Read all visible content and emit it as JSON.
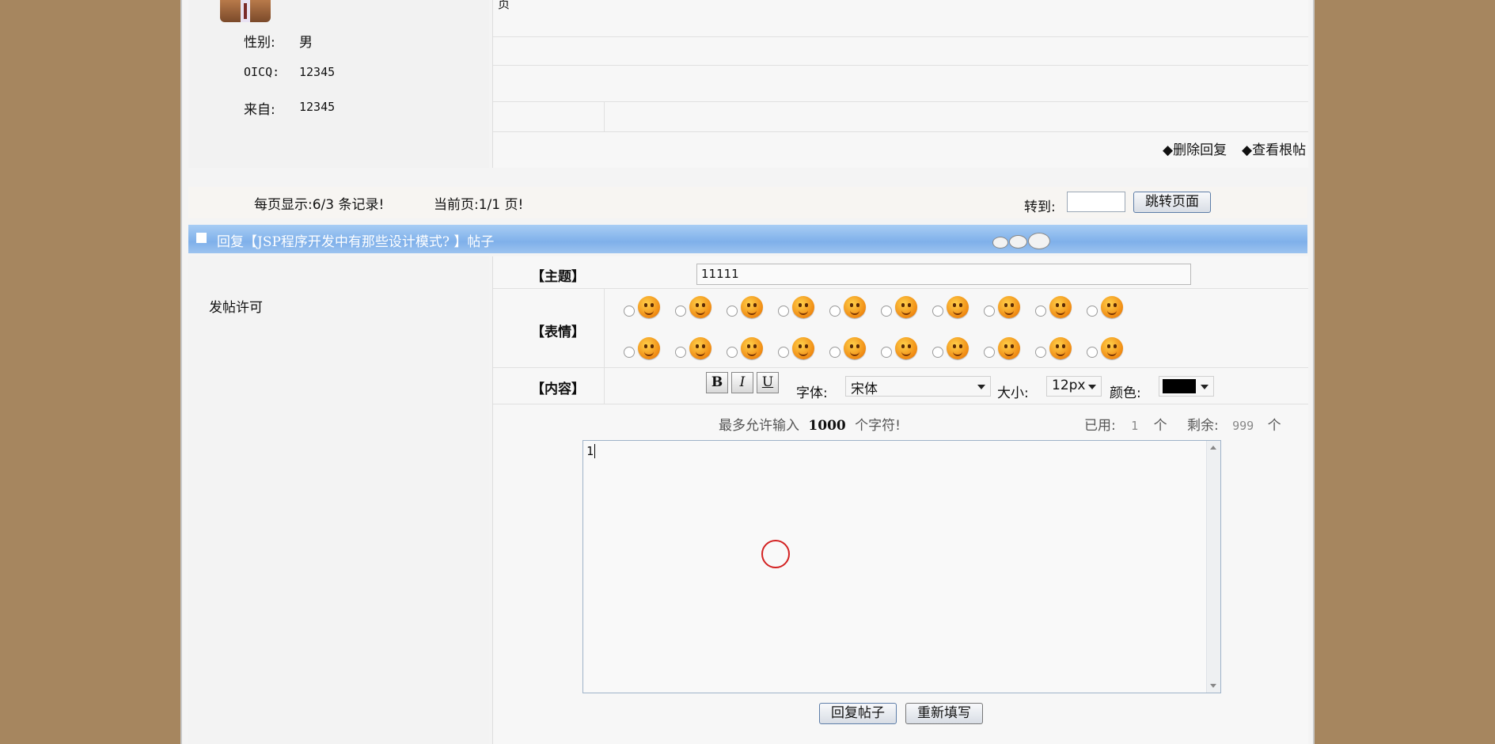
{
  "profile": {
    "gender_label": "性别:",
    "gender_value": "男",
    "oicq_label": "OICQ:",
    "oicq_value": "12345",
    "from_label": "来自:",
    "from_value": "12345",
    "top_text_fragment": "页"
  },
  "post_actions": {
    "delete_reply": "◆删除回复",
    "view_root": "◆查看根帖"
  },
  "pager": {
    "per_page_text": "每页显示:6/3 条记录!",
    "current_page_text": "当前页:1/1 页!",
    "goto_label": "转到:",
    "goto_value": "",
    "jump_button": "跳转页面"
  },
  "reply_bar": {
    "title": "回复【JSP程序开发中有那些设计模式? 】帖子"
  },
  "left_panel": {
    "permission_text": "发帖许可"
  },
  "form": {
    "subject_label": "【主题】",
    "subject_value": "11111",
    "emotion_label": "【表情】",
    "content_label": "【内容】",
    "bold_label": "B",
    "italic_label": "I",
    "underline_label": "U",
    "font_label": "字体:",
    "font_value": "宋体",
    "size_label": "大小:",
    "size_value": "12px",
    "color_label": "颜色:",
    "color_value": "#000000",
    "limit_prefix": "最多允许输入",
    "limit_number": "1000",
    "limit_suffix": "个字符!",
    "used_label": "已用:",
    "used_value": "1",
    "used_unit": "个",
    "remain_label": "剩余:",
    "remain_value": "999",
    "remain_unit": "个",
    "content_value": "1",
    "submit_button": "回复帖子",
    "reset_button": "重新填写"
  },
  "emotions": {
    "row1": [
      "face-smile-icon",
      "face-grin-icon",
      "face-love-icon",
      "face-surprised-icon",
      "face-angry-icon",
      "face-sad-icon",
      "face-wink-icon",
      "face-shy-icon",
      "face-laugh-icon",
      "face-worried-icon"
    ],
    "row2": [
      "face-mad-icon",
      "face-kiss-icon",
      "face-cry-icon",
      "face-cool-icon",
      "face-sunglasses-icon",
      "face-sick-icon",
      "face-blush-icon",
      "face-happy-icon",
      "face-confused-icon",
      "face-question-icon"
    ]
  },
  "colors": {
    "title_bar": "#8dbbee",
    "page_bg": "#a6865f"
  }
}
